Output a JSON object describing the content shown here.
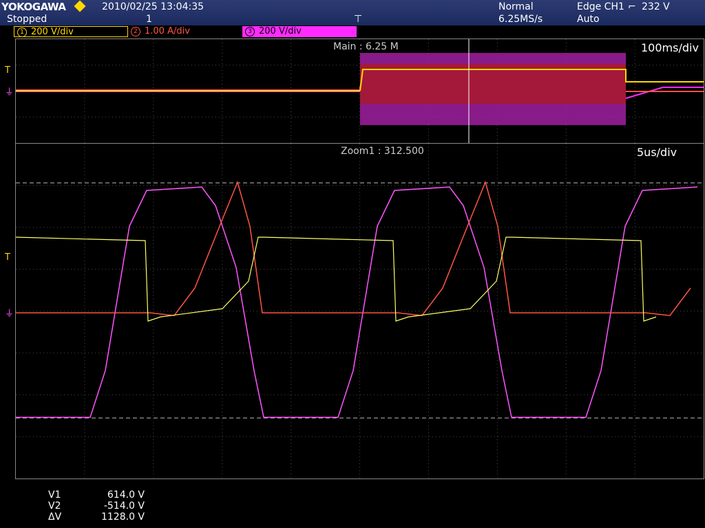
{
  "header": {
    "brand": "YOKOGAWA",
    "date_time": "2010/02/25 13:04:35",
    "status": "Stopped",
    "acq_count": "1",
    "acq_mode": "Normal",
    "sample_rate": "6.25MS/s",
    "trigger_desc": "Edge CH1",
    "trigger_level": "232 V",
    "trigger_mode": "Auto"
  },
  "channels": [
    {
      "num": "1",
      "scale": "200 V/div",
      "color": "#ffd800"
    },
    {
      "num": "2",
      "scale": "1.00 A/div",
      "color": "#ff5544"
    },
    {
      "num": "3",
      "scale": "200 V/div",
      "color": "#ff2aff"
    }
  ],
  "main_window": {
    "label": "Main : 6.25 M",
    "timebase": "100ms/div"
  },
  "zoom_window": {
    "label": "Zoom1 : 312.500",
    "timebase": "5us/div"
  },
  "measurements": [
    {
      "label": "V1",
      "value": "614.0 V"
    },
    {
      "label": "V2",
      "value": "-514.0 V"
    },
    {
      "label": "ΔV",
      "value": "1128.0 V"
    }
  ],
  "colors": {
    "ch1": "#ffd800",
    "ch2": "#ff5544",
    "ch3": "#ff2aff",
    "grid": "#555555",
    "header_bg": "#1b2a5e"
  }
}
